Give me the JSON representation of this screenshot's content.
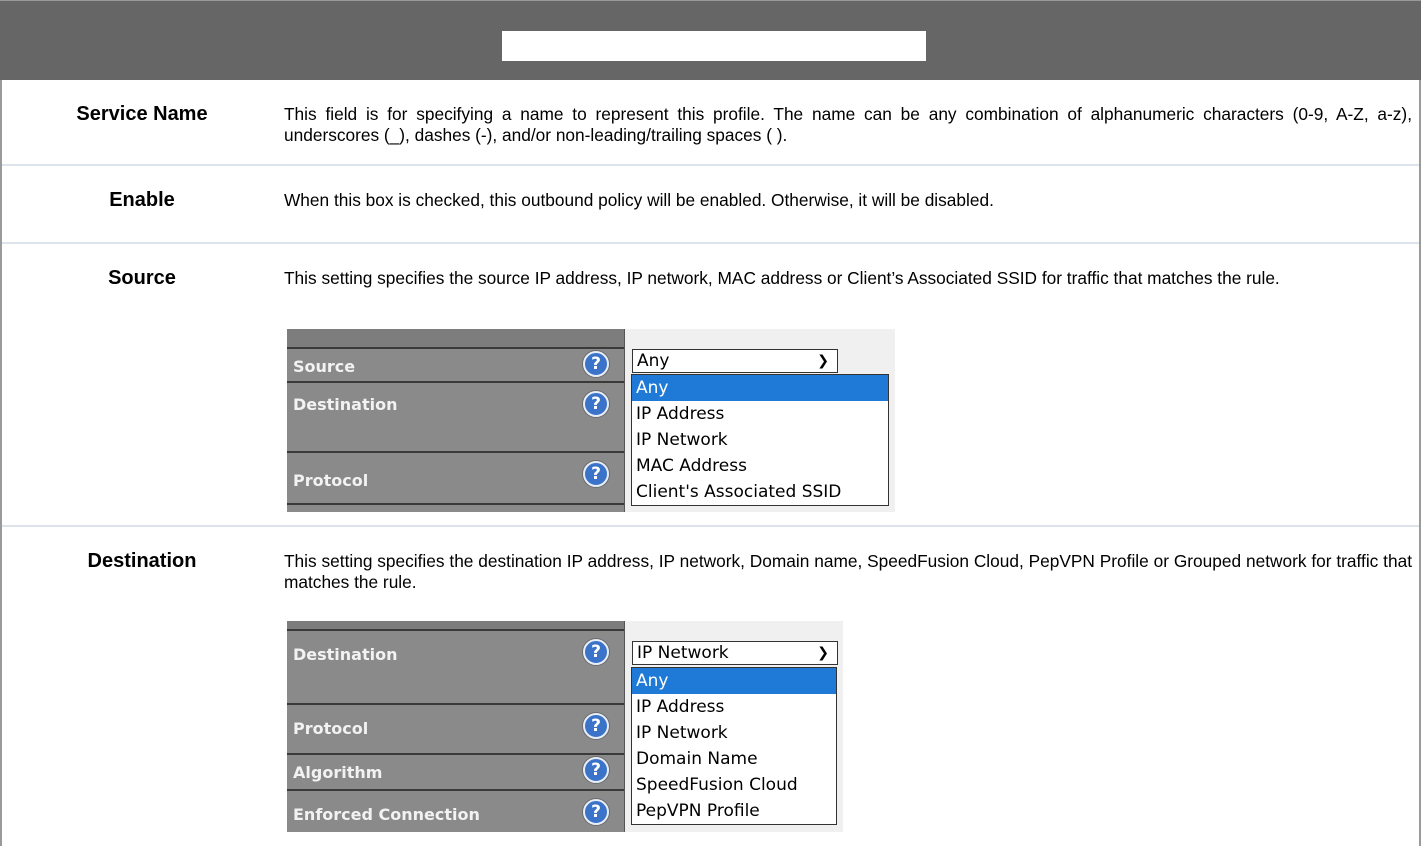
{
  "header": {
    "title": ""
  },
  "rows": [
    {
      "label": "Service Name",
      "description": "This field is for specifying a name to represent this profile. The name can be any combination of alphanumeric characters (0-9, A-Z, a-z), underscores (_), dashes (-), and/or non-leading/trailing spaces ( )."
    },
    {
      "label": "Enable",
      "description": "When this box is checked, this outbound policy will be enabled. Otherwise, it will be disabled."
    },
    {
      "label": "Source",
      "description": "This setting specifies the source IP address, IP network, MAC address or Client’s Associated SSID for traffic that matches the rule."
    },
    {
      "label": "Destination",
      "description": "This setting specifies the destination IP address, IP network, Domain name, SpeedFusion Cloud, PepVPN Profile or Grouped network for traffic that matches the rule."
    }
  ],
  "source_shot": {
    "fields": [
      "Source",
      "Destination",
      "Protocol"
    ],
    "selected": "Any",
    "options": [
      "Any",
      "IP Address",
      "IP Network",
      "MAC Address",
      "Client's Associated SSID"
    ],
    "highlighted": "Any"
  },
  "dest_shot": {
    "fields": [
      "Destination",
      "Protocol",
      "Algorithm",
      "Enforced Connection"
    ],
    "selected": "IP Network",
    "options": [
      "Any",
      "IP Address",
      "IP Network",
      "Domain Name",
      "SpeedFusion Cloud",
      "PepVPN Profile"
    ],
    "highlighted": "Any"
  },
  "icons": {
    "help": "?",
    "chevron": "✔"
  },
  "colors": {
    "header_bg": "#666666",
    "divider": "#dde3ea",
    "dropdown_highlight": "#1e7ad6"
  }
}
